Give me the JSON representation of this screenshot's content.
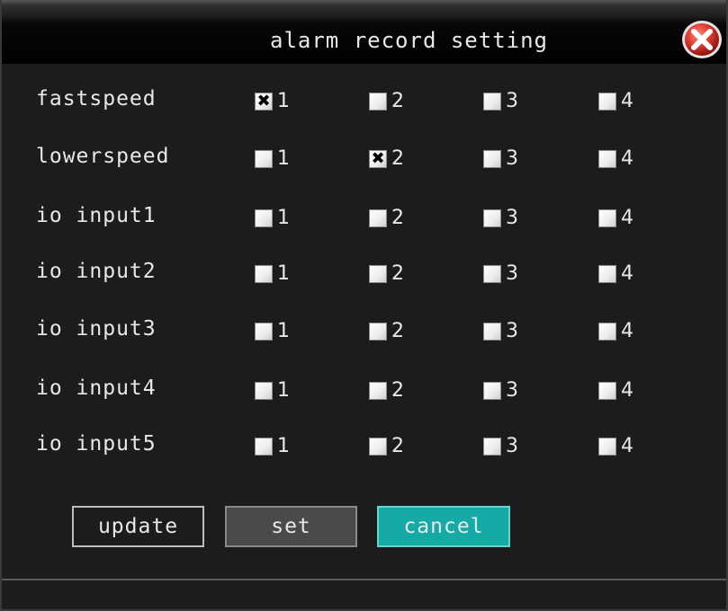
{
  "dialog": {
    "title": "alarm record setting",
    "close_icon": "close-icon"
  },
  "rows": [
    {
      "label": "fastspeed",
      "options": [
        {
          "num": "1",
          "checked": true
        },
        {
          "num": "2",
          "checked": false
        },
        {
          "num": "3",
          "checked": false
        },
        {
          "num": "4",
          "checked": false
        }
      ]
    },
    {
      "label": "lowerspeed",
      "options": [
        {
          "num": "1",
          "checked": false
        },
        {
          "num": "2",
          "checked": true
        },
        {
          "num": "3",
          "checked": false
        },
        {
          "num": "4",
          "checked": false
        }
      ]
    },
    {
      "label": "io input1",
      "options": [
        {
          "num": "1",
          "checked": false
        },
        {
          "num": "2",
          "checked": false
        },
        {
          "num": "3",
          "checked": false
        },
        {
          "num": "4",
          "checked": false
        }
      ]
    },
    {
      "label": "io input2",
      "options": [
        {
          "num": "1",
          "checked": false
        },
        {
          "num": "2",
          "checked": false
        },
        {
          "num": "3",
          "checked": false
        },
        {
          "num": "4",
          "checked": false
        }
      ]
    },
    {
      "label": "io input3",
      "options": [
        {
          "num": "1",
          "checked": false
        },
        {
          "num": "2",
          "checked": false
        },
        {
          "num": "3",
          "checked": false
        },
        {
          "num": "4",
          "checked": false
        }
      ]
    },
    {
      "label": "io input4",
      "options": [
        {
          "num": "1",
          "checked": false
        },
        {
          "num": "2",
          "checked": false
        },
        {
          "num": "3",
          "checked": false
        },
        {
          "num": "4",
          "checked": false
        }
      ]
    },
    {
      "label": "io input5",
      "options": [
        {
          "num": "1",
          "checked": false
        },
        {
          "num": "2",
          "checked": false
        },
        {
          "num": "3",
          "checked": false
        },
        {
          "num": "4",
          "checked": false
        }
      ]
    }
  ],
  "buttons": {
    "update": "update",
    "set": "set",
    "cancel": "cancel"
  },
  "colors": {
    "background": "#1c1c1c",
    "text": "#e8e8e8",
    "accent_cancel": "#16aaa6",
    "close_red": "#d8392f"
  }
}
